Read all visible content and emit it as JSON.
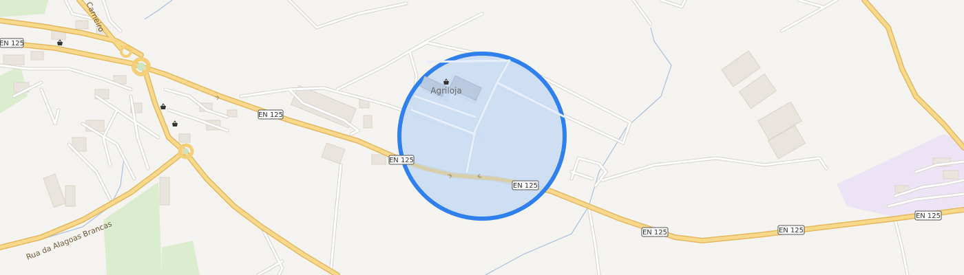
{
  "map": {
    "colors": {
      "background": "#f5f3ef",
      "major_road": "#f6d58a",
      "major_road_casing": "#e3b85c",
      "minor_road": "#ffffff",
      "minor_road_casing": "#d8d6d2",
      "building": "#e9e4dd",
      "building_outline": "#dad3ca",
      "park": "#dceccf",
      "industrial": "#ece4f4",
      "water": "#9ab6d8",
      "highlight_fill": "#c7d9f3",
      "highlight_stroke": "#2f80ed"
    },
    "road_labels": [
      {
        "name": "en125-shield-1",
        "text": "EN 125"
      },
      {
        "name": "en125-shield-2",
        "text": "EN 125"
      },
      {
        "name": "en125-shield-3",
        "text": "EN 125"
      },
      {
        "name": "en125-shield-4",
        "text": "EN 125"
      },
      {
        "name": "en125-shield-5",
        "text": "EN 125"
      },
      {
        "name": "en125-shield-6",
        "text": "EN 125"
      },
      {
        "name": "en125-shield-7",
        "text": "EN 125"
      }
    ],
    "poi": {
      "agriloja": {
        "label": "Agriloja",
        "icon": "shop-basket-icon"
      }
    },
    "poi_icons": [
      "shop-basket-icon",
      "shop-basket-icon",
      "shop-basket-icon"
    ],
    "street_labels": {
      "rua_alagoas": "Rua da Alagoas Brancas",
      "carneiro": "Carneiro"
    }
  }
}
